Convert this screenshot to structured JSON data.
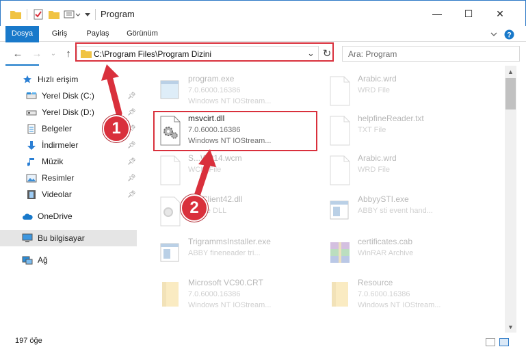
{
  "window": {
    "title": "Program",
    "controls": {
      "minimize": "—",
      "maximize": "☐",
      "close": "✕"
    }
  },
  "ribbon": {
    "tabs": [
      "Dosya",
      "Giriş",
      "Paylaş",
      "Görünüm"
    ],
    "help": "?"
  },
  "nav": {
    "back": "←",
    "forward": "→",
    "up": "↑",
    "address": "C:\\Program Files\\Program Dizini",
    "search_placeholder": "Ara: Program",
    "refresh": "↻",
    "dropdown": "⌄"
  },
  "sidebar": {
    "quick_access": "Hızlı erişim",
    "items": [
      {
        "label": "Yerel Disk (C:)",
        "icon": "drive-icon",
        "pinned": true
      },
      {
        "label": "Yerel Disk (D:)",
        "icon": "drive-icon",
        "pinned": true
      },
      {
        "label": "Belgeler",
        "icon": "documents-icon",
        "pinned": true
      },
      {
        "label": "İndirmeler",
        "icon": "downloads-icon",
        "pinned": true
      },
      {
        "label": "Müzik",
        "icon": "music-icon",
        "pinned": true
      },
      {
        "label": "Resimler",
        "icon": "pictures-icon",
        "pinned": true
      },
      {
        "label": "Videolar",
        "icon": "videos-icon",
        "pinned": true
      }
    ],
    "onedrive": "OneDrive",
    "this_pc": "Bu bilgisayar",
    "network": "Ağ"
  },
  "files": {
    "items": [
      {
        "name": "program.exe",
        "meta1": "7.0.6000.16386",
        "meta2": "Windows NT IOStream...",
        "icon": "exe-icon",
        "faded": true
      },
      {
        "name": "Arabic.wrd",
        "meta1": "WRD File",
        "meta2": "",
        "icon": "blank-file-icon",
        "faded": true
      },
      {
        "name": "msvcirt.dll",
        "meta1": "7.0.6000.16386",
        "meta2": "Windows NT IOStream...",
        "icon": "dll-gear-icon",
        "faded": false
      },
      {
        "name": "helpfineReader.txt",
        "meta1": "TXT File",
        "meta2": "",
        "icon": "blank-file-icon",
        "faded": true
      },
      {
        "name": "S...WP14.wcm",
        "meta1": "WCM File",
        "meta2": "",
        "icon": "blank-file-icon",
        "faded": true
      },
      {
        "name": "Arabic.wrd",
        "meta1": "WRD File",
        "meta2": "",
        "icon": "blank-file-icon",
        "faded": true
      },
      {
        "name": "...teClient42.dll",
        "meta1": "...ance DLL",
        "meta2": "",
        "icon": "dll-gear-icon",
        "faded": true
      },
      {
        "name": "AbbyySTI.exe",
        "meta1": "ABBY sti event hand...",
        "meta2": "",
        "icon": "exe-icon",
        "faded": true
      },
      {
        "name": "TrigrammsInstaller.exe",
        "meta1": "ABBY fineneader tri...",
        "meta2": "",
        "icon": "exe-icon",
        "faded": true
      },
      {
        "name": "certificates.cab",
        "meta1": "WinRAR Archive",
        "meta2": "",
        "icon": "archive-icon",
        "faded": true
      },
      {
        "name": "Microsoft VC90.CRT",
        "meta1": "7.0.6000.16386",
        "meta2": "Windows NT IOStream...",
        "icon": "folder-icon",
        "faded": true
      },
      {
        "name": "Resource",
        "meta1": "7.0.6000.16386",
        "meta2": "Windows NT IOStream...",
        "icon": "folder-icon",
        "faded": true
      }
    ]
  },
  "status": {
    "count": "197 öğe"
  },
  "markers": {
    "step1": "1",
    "step2": "2"
  },
  "colors": {
    "accent": "#1979ca",
    "highlight": "#d9303c",
    "folder": "#f0c343"
  }
}
